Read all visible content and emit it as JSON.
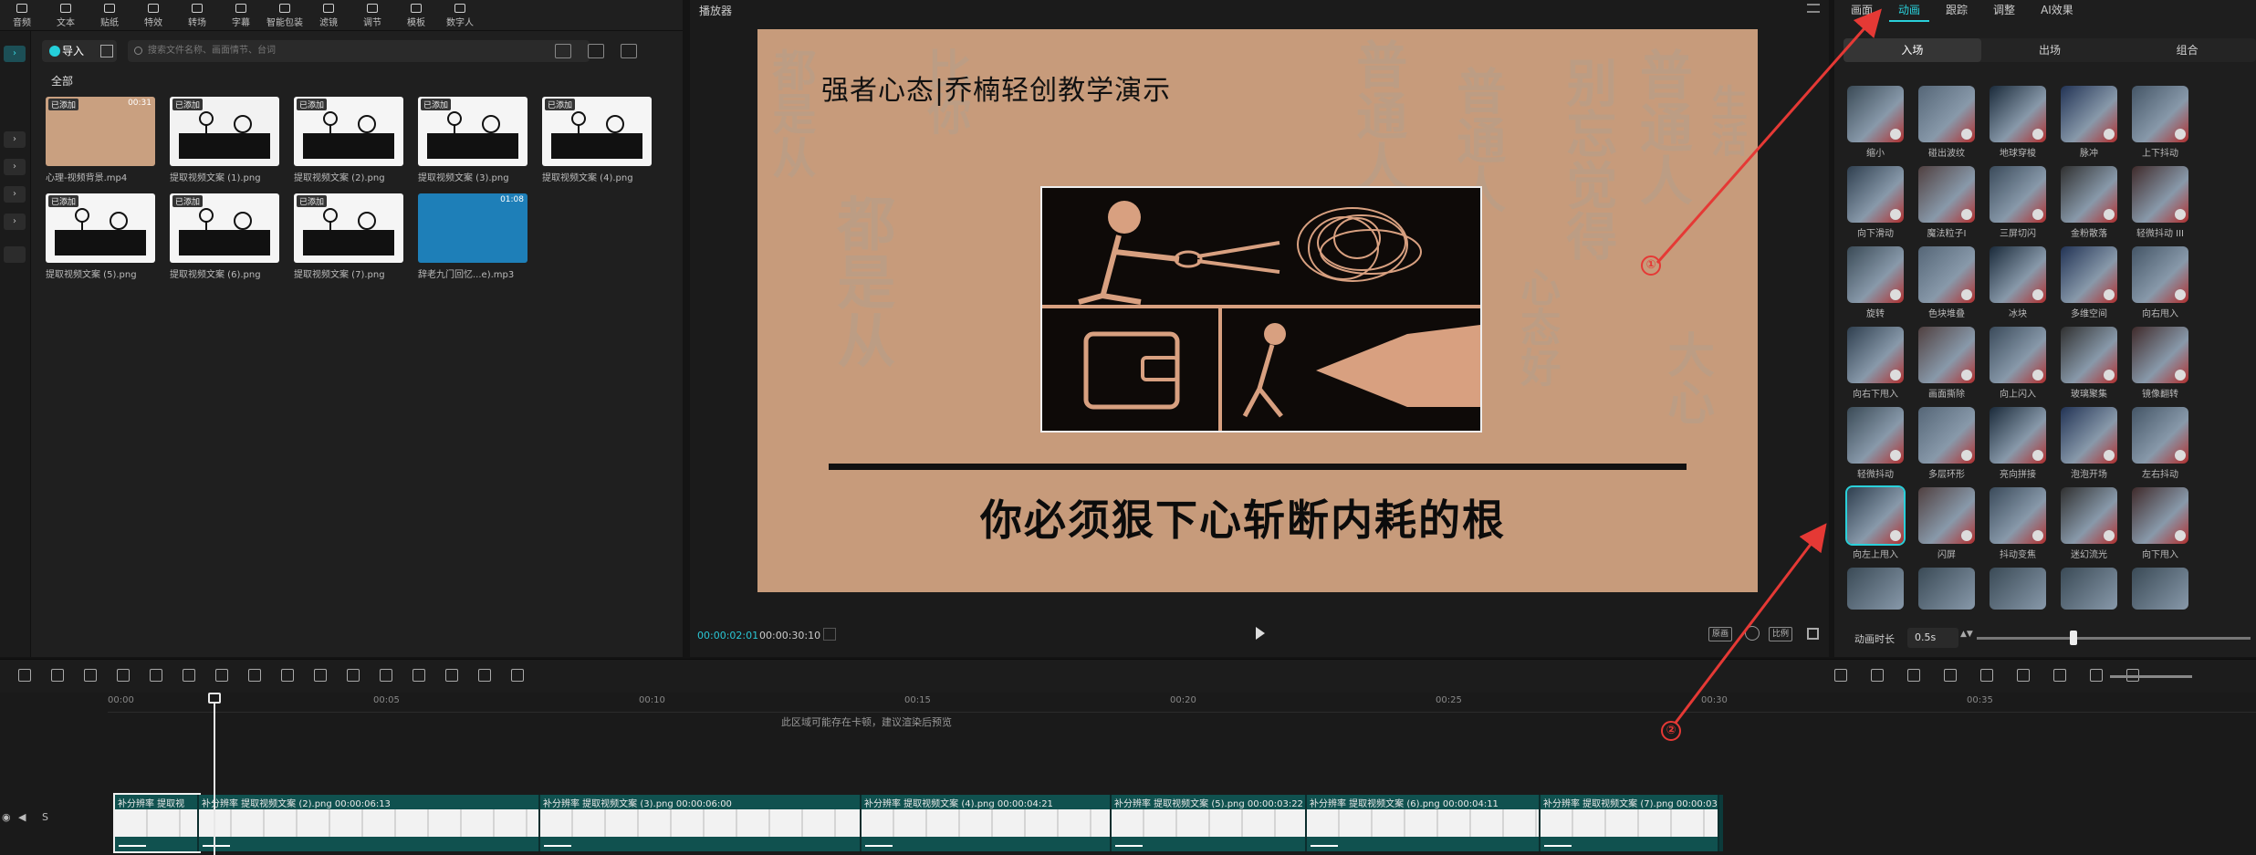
{
  "toolbar": {
    "items": [
      "音频",
      "文本",
      "贴纸",
      "特效",
      "转场",
      "字幕",
      "智能包装",
      "滤镜",
      "调节",
      "模板",
      "数字人"
    ]
  },
  "media": {
    "import_label": "导入",
    "search_placeholder": "搜索文件名称、画面情节、台词",
    "all_label": "全部",
    "items": [
      {
        "name": "心理-视频背景.mp4",
        "badge": "已添加",
        "duration": "00:31"
      },
      {
        "name": "提取视频文案 (1).png",
        "badge": "已添加",
        "duration": ""
      },
      {
        "name": "提取视频文案 (2).png",
        "badge": "已添加",
        "duration": ""
      },
      {
        "name": "提取视频文案 (3).png",
        "badge": "已添加",
        "duration": ""
      },
      {
        "name": "提取视频文案 (4).png",
        "badge": "已添加",
        "duration": ""
      },
      {
        "name": "提取视频文案 (5).png",
        "badge": "已添加",
        "duration": ""
      },
      {
        "name": "提取视频文案 (6).png",
        "badge": "已添加",
        "duration": ""
      },
      {
        "name": "提取视频文案 (7).png",
        "badge": "已添加",
        "duration": ""
      },
      {
        "name": "辞老九门回忆...e).mp3",
        "badge": "",
        "duration": "01:08"
      }
    ]
  },
  "player": {
    "title": "播放器",
    "video_title": "强者心态|乔楠轻创教学演示",
    "subtitle": "你必须狠下心斩断内耗的根",
    "watermark": [
      "都是从",
      "心态好",
      "普通人",
      "别忘觉得",
      "比你",
      "大心",
      "生活"
    ],
    "time_current": "00:00:02:01",
    "time_total": "00:00:30:10",
    "btn_fit": "原画",
    "btn_ratio": "比例"
  },
  "right_panel": {
    "tabs": [
      "画面",
      "动画",
      "跟踪",
      "调整",
      "AI效果"
    ],
    "active_tab": "动画",
    "sub_tabs": [
      "入场",
      "出场",
      "组合"
    ],
    "active_sub_tab": "入场",
    "effects": [
      "缩小",
      "碰出波纹",
      "地球穿梭",
      "脉冲",
      "上下抖动",
      "向下滑动",
      "魔法粒子I",
      "三屏切闪",
      "金粉散落",
      "轻微抖动 III",
      "旋转",
      "色块堆叠",
      "冰块",
      "多维空间",
      "向右甩入",
      "向右下甩入",
      "画面撕除",
      "向上闪入",
      "玻璃聚集",
      "镜像翻转",
      "轻微抖动",
      "多层环形",
      "亮向拼接",
      "泡泡开场",
      "左右抖动",
      "向左上甩入",
      "闪屏",
      "抖动变焦",
      "迷幻流光",
      "向下甩入"
    ],
    "selected_effect": "向左上甩入",
    "duration_label": "动画时长",
    "duration_value": "0.5s"
  },
  "timeline": {
    "ruler": [
      "00:00",
      "00:05",
      "00:10",
      "00:15",
      "00:20",
      "00:25",
      "00:30",
      "00:35"
    ],
    "hint": "此区域可能存在卡顿，建议渲染后预览",
    "clips": [
      {
        "label": "补分辨率  提取视",
        "dur": ""
      },
      {
        "label": "补分辨率  提取视频文案 (2).png  00:00:06:13",
        "dur": ""
      },
      {
        "label": "补分辨率  提取视频文案 (3).png  00:00:06:00",
        "dur": ""
      },
      {
        "label": "补分辨率  提取视频文案 (4).png  00:00:04:21",
        "dur": ""
      },
      {
        "label": "补分辨率  提取视频文案 (5).png  00:00:03:22",
        "dur": ""
      },
      {
        "label": "补分辨率  提取视频文案 (6).png  00:00:04:11",
        "dur": ""
      },
      {
        "label": "补分辨率  提取视频文案 (7).png  00:00:03",
        "dur": ""
      }
    ]
  },
  "annotations": {
    "one": "①",
    "two": "②"
  },
  "colors": {
    "accent": "#2ad0da",
    "annotation": "#e53935",
    "canvas_bg": "#c79b7b"
  }
}
